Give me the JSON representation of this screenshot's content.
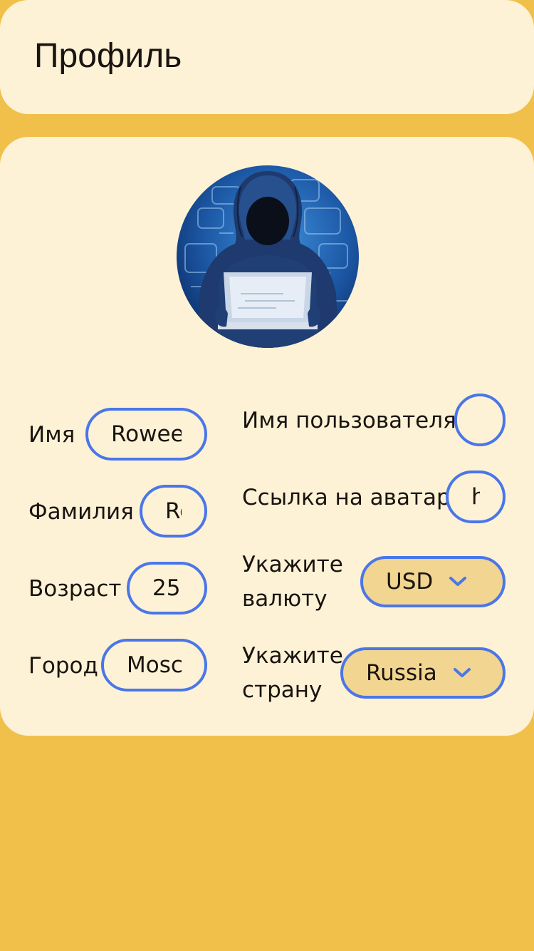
{
  "header": {
    "title": "Профиль"
  },
  "form": {
    "first_name": {
      "label": "Имя",
      "value": "Roweenn"
    },
    "last_name": {
      "label": "Фамилия",
      "value": "Roweenn"
    },
    "age": {
      "label": "Возраст",
      "value": "25"
    },
    "city": {
      "label": "Город",
      "value": "Moscow"
    },
    "username": {
      "label": "Имя пользователя",
      "value": ""
    },
    "avatar_link": {
      "label": "Ссылка на аватар",
      "value": "https"
    },
    "currency": {
      "label": "Укажите валюту",
      "value": "USD"
    },
    "country": {
      "label": "Укажите страну",
      "value": "Russia"
    }
  },
  "colors": {
    "background": "#f0c04b",
    "card": "#fdf2d6",
    "accent": "#4a76e8",
    "select_fill": "#f1d590"
  },
  "icons": {
    "select_arrow": "chevron-down-icon",
    "avatar": "hooded-hacker-avatar"
  }
}
